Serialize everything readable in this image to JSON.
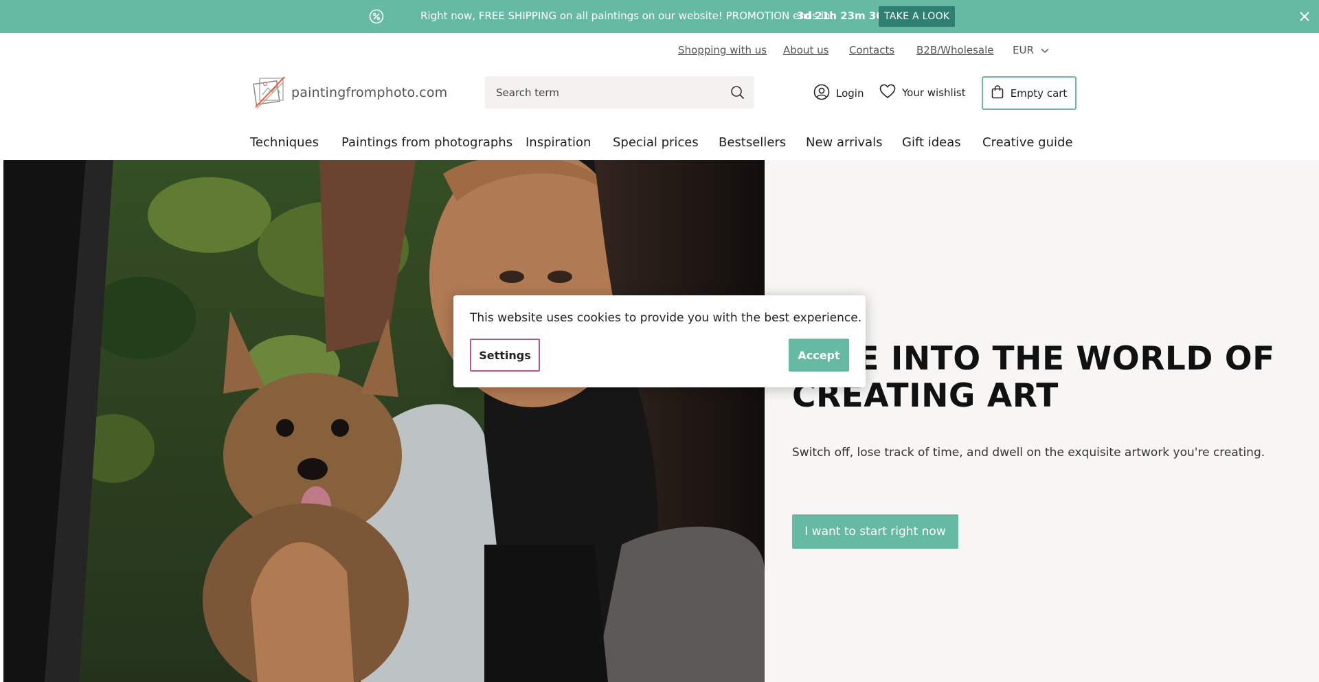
{
  "promo": {
    "icon": "discount-icon",
    "text": "Right now, FREE SHIPPING on all paintings on our website! PROMOTION ends in:",
    "countdown": "3d 21h 23m 30s",
    "cta_label": "TAKE A LOOK",
    "close_icon": "close-icon",
    "bg_color": "#66b9a2",
    "cta_color": "#2f7f73"
  },
  "top_links": {
    "shopping": "Shopping with us",
    "about": "About us",
    "contacts": "Contacts",
    "b2b": "B2B/Wholesale",
    "currency": "EUR"
  },
  "header": {
    "logo_text": "paintingfromphoto.com",
    "search_placeholder": "Search term",
    "login_label": "Login",
    "wishlist_label": "Your wishlist",
    "cart_label": "Empty cart"
  },
  "nav": {
    "items": [
      "Techniques",
      "Paintings from photographs",
      "Inspiration",
      "Special prices",
      "Bestsellers",
      "New arrivals",
      "Gift ideas",
      "Creative guide"
    ]
  },
  "hero": {
    "title": "DIVE INTO THE WORLD OF CREATING ART",
    "subtitle": "Switch off, lose track of time, and dwell on the exquisite artwork you're creating.",
    "cta_label": "I want to start right now",
    "accent_color": "#66b9a2"
  },
  "cookie": {
    "text": "This website uses cookies to provide you with the best experience.",
    "settings_label": "Settings",
    "accept_label": "Accept"
  }
}
